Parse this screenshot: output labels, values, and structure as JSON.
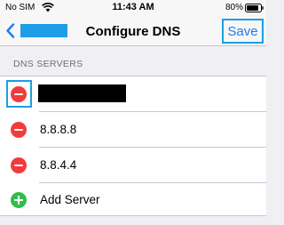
{
  "status_bar": {
    "carrier": "No SIM",
    "time": "11:43 AM",
    "battery": "80%"
  },
  "nav": {
    "title": "Configure DNS",
    "save_label": "Save",
    "accent": "#1d7cf2",
    "highlight_color": "#1c9ee3"
  },
  "section": {
    "header": "DNS SERVERS",
    "items": [
      {
        "label": "",
        "action": "remove",
        "redacted": true
      },
      {
        "label": "8.8.8.8",
        "action": "remove"
      },
      {
        "label": "8.8.4.4",
        "action": "remove"
      },
      {
        "label": "Add Server",
        "action": "add"
      }
    ]
  },
  "colors": {
    "remove": "#f23b3b",
    "add": "#2fbf4a"
  }
}
